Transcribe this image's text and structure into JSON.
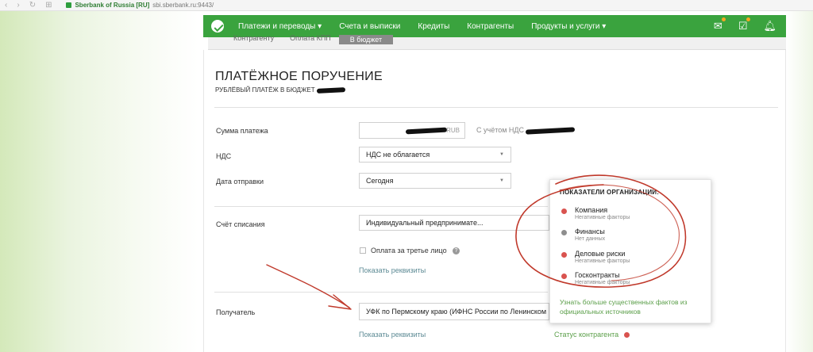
{
  "browser": {
    "site_name": "Sberbank of Russia [RU]",
    "url": "sbi.sberbank.ru:9443/"
  },
  "nav": {
    "items": [
      "Платежи и переводы",
      "Счета и выписки",
      "Кредиты",
      "Контрагенты",
      "Продукты и услуги"
    ]
  },
  "tabs": {
    "items": [
      "Контрагенту",
      "Оплата КПП"
    ],
    "active": "В бюджет"
  },
  "document": {
    "title": "ПЛАТЁЖНОЕ ПОРУЧЕНИЕ",
    "subtitle": "РУБЛЁВЫЙ ПЛАТЁЖ В БЮДЖЕТ"
  },
  "form": {
    "amount_label": "Сумма платежа",
    "amount_unit": "RUB",
    "amount_hint": "С учётом НДС",
    "vat_label": "НДС",
    "vat_value": "НДС не облагается",
    "date_label": "Дата отправки",
    "date_value": "Сегодня",
    "account_label": "Счёт списания",
    "account_value": "Индивидуальный предпринимате...",
    "third_party_label": "Оплата за третье лицо",
    "show_details_1": "Показать реквизиты",
    "recipient_label": "Получатель",
    "recipient_value": "УФК по Пермскому краю (ИФНС России по Ленинском",
    "show_details_2": "Показать реквизиты",
    "status_link": "Статус контрагента"
  },
  "popup": {
    "title": "ПОКАЗАТЕЛИ ОРГАНИЗАЦИИ:",
    "indicators": [
      {
        "name": "Компания",
        "desc": "Негативные факторы",
        "color": "#d9534f"
      },
      {
        "name": "Финансы",
        "desc": "Нет данных",
        "color": "#8e8e8e"
      },
      {
        "name": "Деловые риски",
        "desc": "Негативные факторы",
        "color": "#d9534f"
      },
      {
        "name": "Госконтракты",
        "desc": "Негативные факторы",
        "color": "#d9534f"
      }
    ],
    "more_link": "Узнать больше существенных фактов из официальных источников"
  },
  "colors": {
    "brand_green": "#3aa33e",
    "negative": "#d9534f",
    "neutral": "#8e8e8e",
    "link_green": "#5a9e48",
    "annotation_red": "#c0392b"
  }
}
